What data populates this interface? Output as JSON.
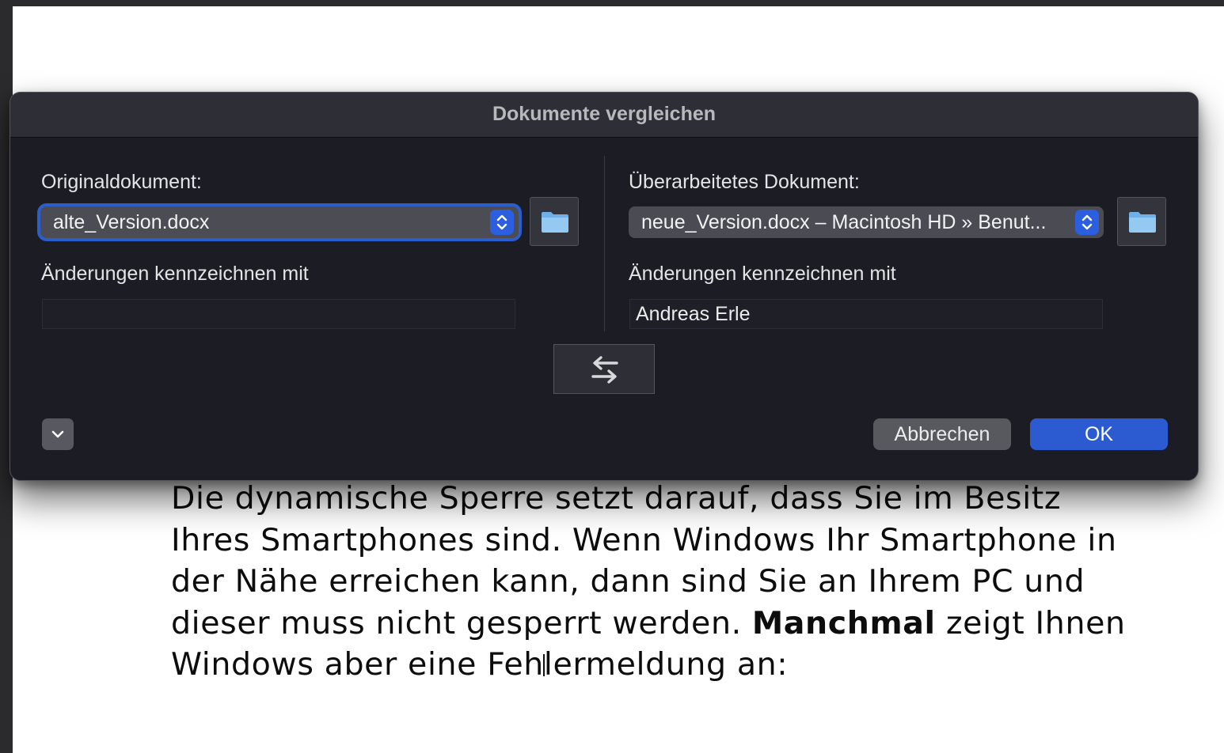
{
  "document": {
    "lines": [
      "Die dynamische Sperre setzt darauf, dass Sie im Besitz",
      "Ihres Smartphones sind. Wenn Windows Ihr Smartphone in",
      "der Nähe erreichen kann, dann sind Sie an Ihrem PC und"
    ],
    "line4_before": "dieser muss nicht gesperrt werden. ",
    "line4_bold": "Manchmal",
    "line4_after": " zeigt Ihnen",
    "line5_before_cursor": "Windows aber eine Feh",
    "line5_after_cursor": "lermeldung an:"
  },
  "dialog": {
    "title": "Dokumente vergleichen",
    "original": {
      "label": "Originaldokument:",
      "selected": "alte_Version.docx",
      "mark_label": "Änderungen kennzeichnen mit",
      "mark_value": ""
    },
    "revised": {
      "label": "Überarbeitetes Dokument:",
      "selected": "neue_Version.docx – Macintosh HD » Benut...",
      "mark_label": "Änderungen kennzeichnen mit",
      "mark_value": "Andreas Erle"
    },
    "buttons": {
      "cancel": "Abbrechen",
      "ok": "OK"
    }
  },
  "icons": {
    "folder": "folder-icon",
    "swap": "swap-arrows-icon",
    "stepper": "up-down-chevron-icon",
    "disclosure": "chevron-down-icon"
  },
  "colors": {
    "accent": "#2c5ad0",
    "folder": "#8ec3ef"
  }
}
